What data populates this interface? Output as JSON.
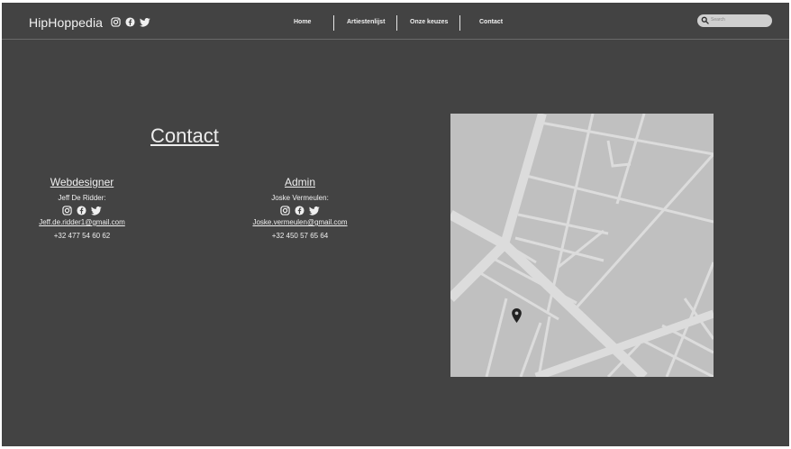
{
  "site": {
    "brand": "HipHoppedia"
  },
  "nav": {
    "home": "Home",
    "artists": "Artiestenlijst",
    "choices": "Onze keuzes",
    "contact": "Contact"
  },
  "search": {
    "placeholder": "Search"
  },
  "page": {
    "title": "Contact"
  },
  "contacts": [
    {
      "role": "Webdesigner ",
      "name": "Jeff De Ridder:",
      "email": "Jeff.de.ridder1@gmail.com",
      "phone": "+32 477 54 60 62"
    },
    {
      "role": "Admin",
      "name": "Joske Vermeulen:",
      "email": "Joske.vermeulen@gmail.com",
      "phone": "+32 450 57 65 64"
    }
  ],
  "icons": [
    "instagram-icon",
    "facebook-icon",
    "twitter-icon",
    "search-icon",
    "map-pin-icon"
  ],
  "colors": {
    "background": "#434343",
    "text": "#efefef",
    "map_land": "#c0c0c0",
    "map_road": "#dcdcdc",
    "pin": "#222222"
  }
}
